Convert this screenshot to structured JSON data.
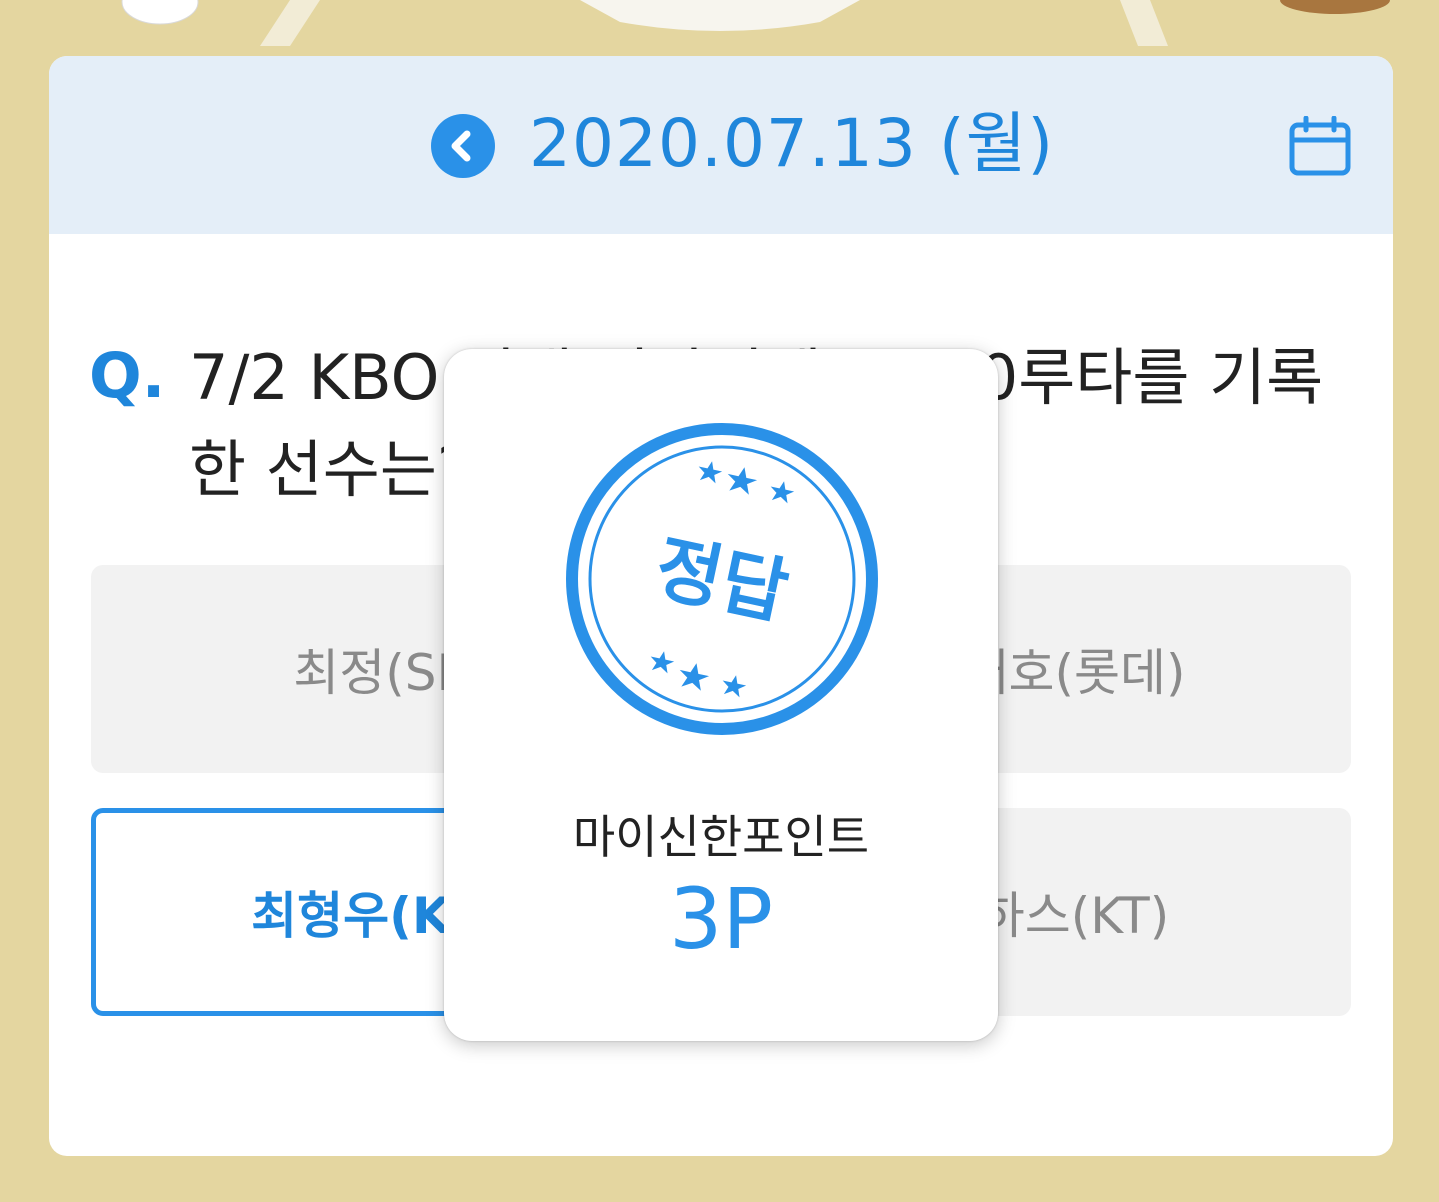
{
  "header": {
    "date": "2020.07.13 (월)"
  },
  "question": {
    "mark": "Q.",
    "text": "7/2 KBO 역대 었답먼째 2,300루타를 기록한 선수는?"
  },
  "options": [
    {
      "label": "최정(SK)"
    },
    {
      "label": "이대호(롯데)"
    },
    {
      "label": "최형우(KIA)"
    },
    {
      "label": "로하스(KT)"
    }
  ],
  "modal": {
    "stamp_text": "정답",
    "point_label": "마이신한포인트",
    "point_value": "3P"
  },
  "colors": {
    "accent": "#2a91e8",
    "background": "#e4d6a0",
    "date_bar": "#e4eef8"
  },
  "icons": {
    "prev": "chevron-left-icon",
    "calendar": "calendar-icon",
    "stars": "star-icon"
  }
}
